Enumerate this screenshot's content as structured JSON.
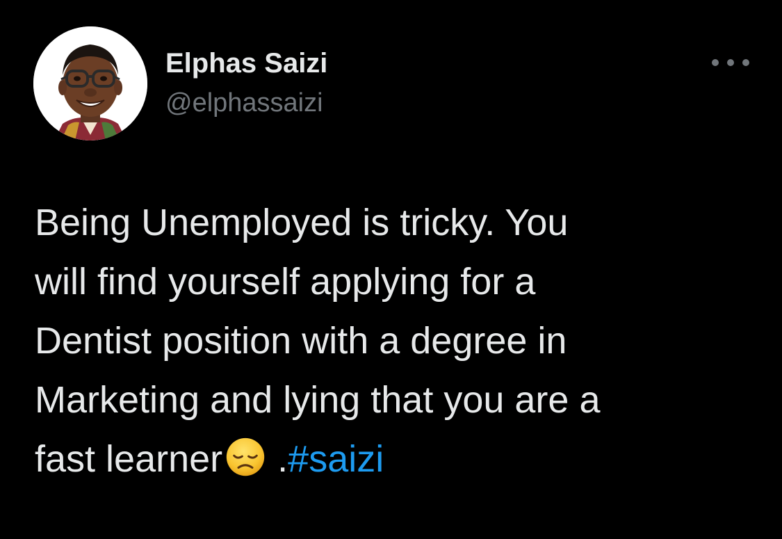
{
  "author": {
    "display_name": "Elphas Saizi",
    "handle": "@elphassaizi",
    "avatar_icon": "profile-photo"
  },
  "more_menu": {
    "icon": "more-horizontal-icon"
  },
  "tweet": {
    "lines": [
      "Being Unemployed is tricky. You",
      "will find yourself applying for a",
      "Dentist position with a degree in",
      "Marketing and lying that you are a"
    ],
    "last_line_text": "fast learner",
    "emoji": "disappointed-face-emoji",
    "after_emoji_text": " .",
    "hashtag": "#saizi"
  },
  "colors": {
    "background": "#000000",
    "text_primary": "#e7e9ea",
    "text_secondary": "#71767b",
    "link": "#1d9bf0"
  }
}
